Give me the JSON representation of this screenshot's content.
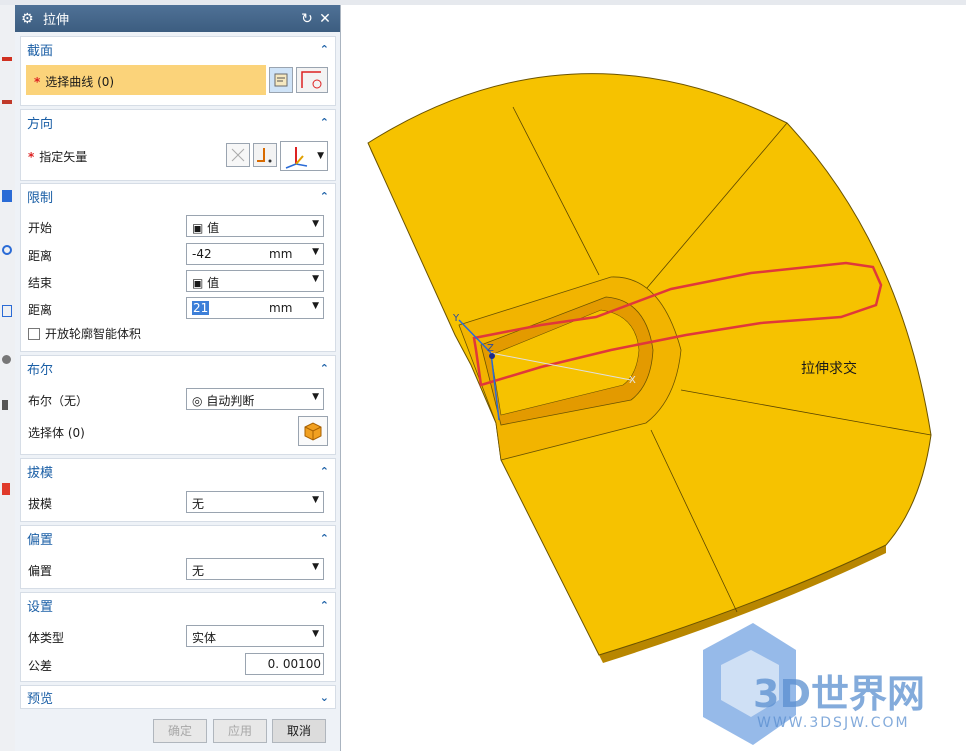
{
  "dialog": {
    "title": "拉伸",
    "sections": {
      "section": {
        "title": "截面",
        "select_curve": "选择曲线 (0)"
      },
      "direction": {
        "title": "方向",
        "specify_vector": "指定矢量"
      },
      "limits": {
        "title": "限制",
        "start_label": "开始",
        "start_value": "值",
        "distance1_label": "距离",
        "distance1_value": "-42",
        "distance1_unit": "mm",
        "end_label": "结束",
        "end_value": "值",
        "distance2_label": "距离",
        "distance2_value": "21",
        "distance2_unit": "mm",
        "open_profile": "开放轮廓智能体积"
      },
      "boolean": {
        "title": "布尔",
        "boolean_label": "布尔（无）",
        "boolean_value": "自动判断",
        "select_body": "选择体 (0)"
      },
      "draft": {
        "title": "拔模",
        "draft_label": "拔模",
        "draft_value": "无"
      },
      "offset": {
        "title": "偏置",
        "offset_label": "偏置",
        "offset_value": "无"
      },
      "settings": {
        "title": "设置",
        "body_type_label": "体类型",
        "body_type_value": "实体",
        "tolerance_label": "公差",
        "tolerance_value": "0. 00100"
      },
      "preview": {
        "title": "预览"
      }
    },
    "buttons": {
      "ok": "确定",
      "apply": "应用",
      "cancel": "取消"
    }
  },
  "viewport": {
    "annotation": "拉伸求交",
    "axis_x": "X",
    "axis_y": "Y",
    "axis_z": "Z",
    "watermark_text": "3D世界网",
    "watermark_url": "WWW.3DSJW.COM"
  },
  "colors": {
    "part_yellow": "#f6c200",
    "part_side": "#b88600",
    "curve_red": "#e0383a",
    "accent_blue": "#1b5fa6",
    "watermark_blue": "#5a8fd0"
  }
}
